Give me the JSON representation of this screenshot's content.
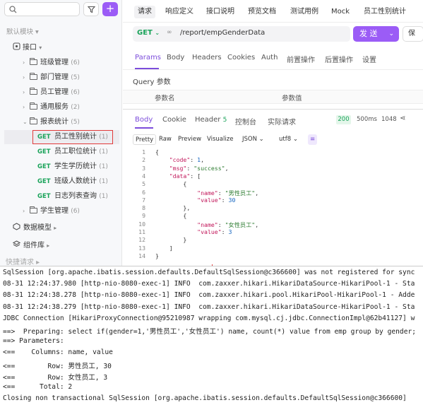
{
  "sidebar": {
    "search_placeholder": "",
    "filter_icon": "filter-icon",
    "add_label": "+",
    "group_label": "默认模块",
    "root_label": "接口",
    "folders": [
      {
        "label": "班级管理",
        "count": "(6)"
      },
      {
        "label": "部门管理",
        "count": "(5)"
      },
      {
        "label": "员工管理",
        "count": "(6)"
      },
      {
        "label": "通用服务",
        "count": "(2)"
      },
      {
        "label": "报表统计",
        "count": "(5)"
      }
    ],
    "endpoints": [
      {
        "method": "GET",
        "label": "员工性别统计",
        "count": "(1)"
      },
      {
        "method": "GET",
        "label": "员工职位统计",
        "count": "(1)"
      },
      {
        "method": "GET",
        "label": "学生学历统计",
        "count": "(1)"
      },
      {
        "method": "GET",
        "label": "班级人数统计",
        "count": "(1)"
      },
      {
        "method": "GET",
        "label": "日志列表查询",
        "count": "(1)"
      }
    ],
    "last_folder": {
      "label": "学生管理",
      "count": "(6)"
    },
    "data_model": "数据模型",
    "components": "组件库",
    "quick_ref": "快捷请求"
  },
  "tabs": [
    "请求",
    "响应定义",
    "接口说明",
    "预览文档",
    "测试用例",
    "Mock",
    "员工性别统计"
  ],
  "request": {
    "method": "GET",
    "url": "/report/empGenderData",
    "send_label": "发 送",
    "save_label": "保"
  },
  "req_tabs": [
    "Params",
    "Body",
    "Headers",
    "Cookies",
    "Auth",
    "前置操作",
    "后置操作",
    "设置"
  ],
  "query": {
    "title": "Query 参数",
    "col_name": "参数名",
    "col_value": "参数值"
  },
  "resp_tabs": [
    "Body",
    "Cookie",
    "Header",
    "控制台",
    "实际请求"
  ],
  "resp_header_count": "5",
  "status": {
    "code": "200",
    "time": "500ms",
    "size": "1048"
  },
  "format_buttons": [
    "Pretty",
    "Raw",
    "Preview",
    "Visualize"
  ],
  "format_select": "JSON",
  "encoding_select": "utf8",
  "code_lines": [
    {
      "n": "1",
      "t": "{"
    },
    {
      "n": "2",
      "t": "    \"code\": 1,"
    },
    {
      "n": "3",
      "t": "    \"msg\": \"success\","
    },
    {
      "n": "4",
      "t": "    \"data\": ["
    },
    {
      "n": "5",
      "t": "        {"
    },
    {
      "n": "6",
      "t": "            \"name\": \"男性员工\","
    },
    {
      "n": "7",
      "t": "            \"value\": 30"
    },
    {
      "n": "8",
      "t": "        },"
    },
    {
      "n": "9",
      "t": "        {"
    },
    {
      "n": "10",
      "t": "            \"name\": \"女性员工\","
    },
    {
      "n": "11",
      "t": "            \"value\": 3"
    },
    {
      "n": "12",
      "t": "        }"
    },
    {
      "n": "13",
      "t": "    ]"
    },
    {
      "n": "14",
      "t": "}"
    }
  ],
  "console_lines": [
    "SqlSession [org.apache.ibatis.session.defaults.DefaultSqlSession@c366600] was not registered for sync",
    "08-31 12:24:37.980 [http-nio-8080-exec-1] INFO  com.zaxxer.hikari.HikariDataSource-HikariPool-1 - Sta",
    "08-31 12:24:38.278 [http-nio-8080-exec-1] INFO  com.zaxxer.hikari.pool.HikariPool-HikariPool-1 - Adde",
    "08-31 12:24:38.279 [http-nio-8080-exec-1] INFO  com.zaxxer.hikari.HikariDataSource-HikariPool-1 - Sta",
    "JDBC Connection [HikariProxyConnection@95210987 wrapping com.mysql.cj.jdbc.ConnectionImpl@62b41127] w",
    "==>  Preparing: select if(gender=1,'男性员工','女性员工') name, count(*) value from emp group by gender;",
    "==> Parameters: ",
    "<==    Columns: name, value",
    "<==        Row: 男性员工, 30",
    "<==        Row: 女性员工, 3",
    "<==      Total: 2",
    "Closing non transactional SqlSession [org.apache.ibatis.session.defaults.DefaultSqlSession@c366600]"
  ]
}
